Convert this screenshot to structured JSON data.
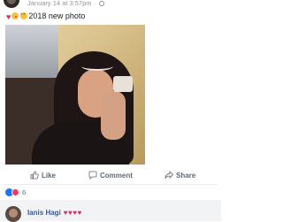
{
  "post": {
    "timestamp": "January 14 at 3:57pm",
    "timestamp_sep": " · ",
    "caption_text": "2018 new photo",
    "caption_emojis": [
      "red-heart",
      "kissing-face",
      "heart-eyes-face"
    ]
  },
  "actions": {
    "like_label": "Like",
    "comment_label": "Comment",
    "share_label": "Share"
  },
  "reactions": {
    "count": "6",
    "types": [
      "like",
      "love"
    ]
  },
  "comment": {
    "author": "Ianis Hagi",
    "text": "♥♥♥♥"
  },
  "colors": {
    "link_blue": "#385898",
    "meta_gray": "#90949c",
    "action_gray": "#606770",
    "like_blue": "#1877f2",
    "love_red": "#f33e58",
    "heart_red": "#e0245e"
  }
}
